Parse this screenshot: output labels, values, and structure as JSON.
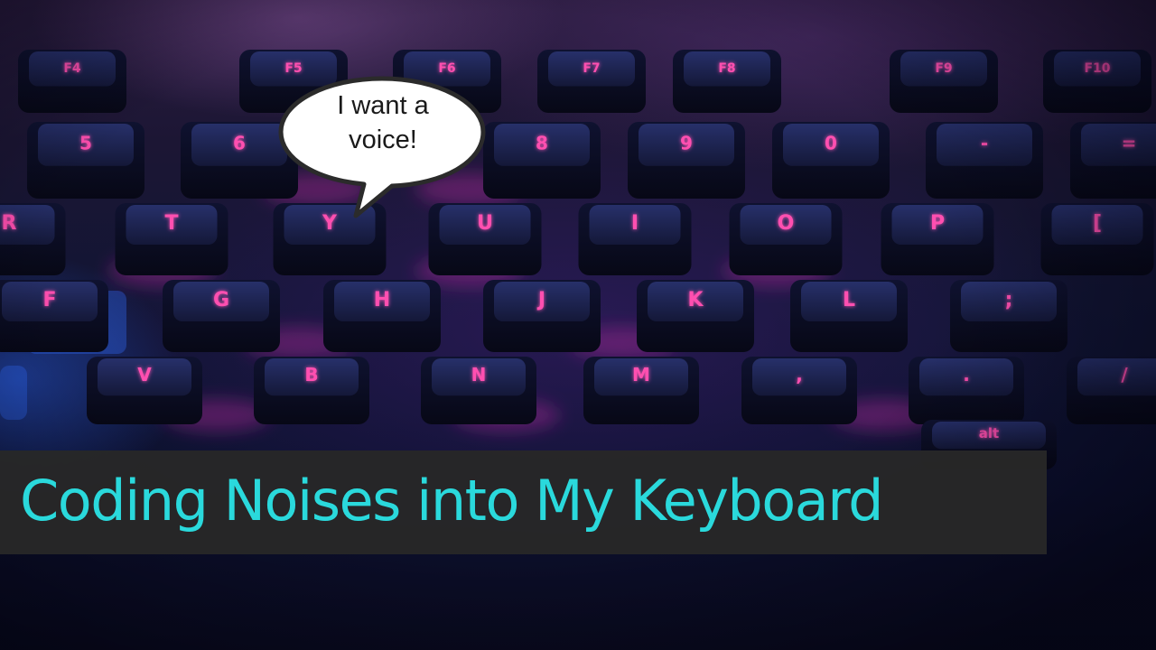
{
  "speech_bubble": {
    "line1": "I want a",
    "line2": "voice!"
  },
  "title": "Coding Noises into My Keyboard",
  "colors": {
    "title_text": "#2ad9dc",
    "title_bar": "#282828",
    "key_legend": "#ff4fb0",
    "key_cap": "#15183a"
  },
  "keyboard": {
    "keys": [
      {
        "row": 0,
        "legend": "F4"
      },
      {
        "row": 0,
        "legend": "F5"
      },
      {
        "row": 0,
        "legend": "F6"
      },
      {
        "row": 0,
        "legend": "F7"
      },
      {
        "row": 0,
        "legend": "F8"
      },
      {
        "row": 0,
        "legend": "F9"
      },
      {
        "row": 0,
        "legend": "F10"
      },
      {
        "row": 1,
        "legend": "5"
      },
      {
        "row": 1,
        "legend": "6"
      },
      {
        "row": 1,
        "legend": "8"
      },
      {
        "row": 1,
        "legend": "9"
      },
      {
        "row": 1,
        "legend": "0"
      },
      {
        "row": 1,
        "legend": "-"
      },
      {
        "row": 1,
        "legend": "="
      },
      {
        "row": 2,
        "legend": "R"
      },
      {
        "row": 2,
        "legend": "T"
      },
      {
        "row": 2,
        "legend": "Y"
      },
      {
        "row": 2,
        "legend": "U"
      },
      {
        "row": 2,
        "legend": "I"
      },
      {
        "row": 2,
        "legend": "O"
      },
      {
        "row": 2,
        "legend": "P"
      },
      {
        "row": 2,
        "legend": "["
      },
      {
        "row": 3,
        "legend": "F"
      },
      {
        "row": 3,
        "legend": "G"
      },
      {
        "row": 3,
        "legend": "H"
      },
      {
        "row": 3,
        "legend": "J"
      },
      {
        "row": 3,
        "legend": "K"
      },
      {
        "row": 3,
        "legend": "L"
      },
      {
        "row": 3,
        "legend": ";"
      },
      {
        "row": 4,
        "legend": "V"
      },
      {
        "row": 4,
        "legend": "B"
      },
      {
        "row": 4,
        "legend": "N"
      },
      {
        "row": 4,
        "legend": "M"
      },
      {
        "row": 4,
        "legend": ","
      },
      {
        "row": 4,
        "legend": "."
      },
      {
        "row": 4,
        "legend": "/"
      },
      {
        "row": 5,
        "legend": "alt"
      }
    ]
  }
}
